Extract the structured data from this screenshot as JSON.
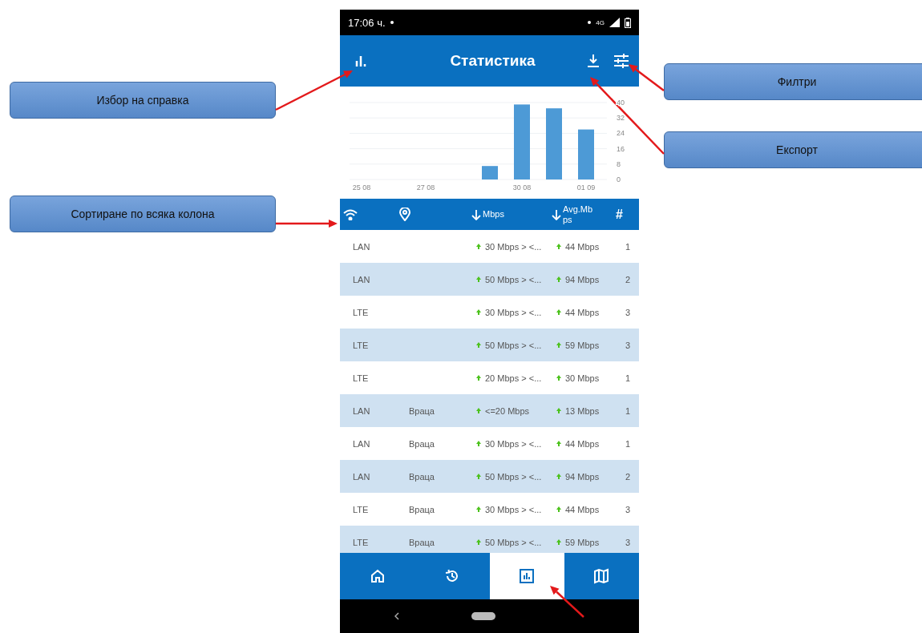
{
  "left_callouts": [
    "Избор на справка",
    "Сортиране по всяка колона"
  ],
  "right_callouts": [
    "Филтри",
    "Експорт"
  ],
  "status_bar": {
    "time": "17:06 ч.",
    "network": "4G"
  },
  "app_bar": {
    "title": "Статистика"
  },
  "chart_data": {
    "type": "bar",
    "categories": [
      "25 08",
      null,
      "27 08",
      null,
      null,
      "30 08",
      null,
      "01 09"
    ],
    "values": [
      null,
      null,
      null,
      null,
      7,
      39,
      37,
      26
    ],
    "grid": true,
    "ylim": [
      0,
      40
    ],
    "yticks": [
      0,
      8,
      16,
      24,
      32,
      40
    ]
  },
  "table": {
    "columns": [
      {
        "kind": "wifi"
      },
      {
        "kind": "location"
      },
      {
        "kind": "sort",
        "label": "Mbps"
      },
      {
        "kind": "sort",
        "label": "Avg.Mbps"
      },
      {
        "kind": "text",
        "label": "#"
      }
    ],
    "rows": [
      {
        "type": "LAN",
        "speed": "30 Mbps > <...",
        "avg": "44 Mbps",
        "count": "1"
      },
      {
        "type": "LAN",
        "speed": "50 Mbps > <...",
        "avg": "94 Mbps",
        "count": "2"
      },
      {
        "type": "LTE",
        "speed": "30 Mbps > <...",
        "avg": "44 Mbps",
        "count": "3"
      },
      {
        "type": "LTE",
        "speed": "50 Mbps > <...",
        "avg": "59 Mbps",
        "count": "3"
      },
      {
        "type": "LTE",
        "speed": "20 Mbps > <...",
        "avg": "30 Mbps",
        "count": "1"
      },
      {
        "type": "LAN",
        "place": "Враца",
        "speed": "<=20 Mbps",
        "avg": "13 Mbps",
        "count": "1"
      },
      {
        "type": "LAN",
        "place": "Враца",
        "speed": "30 Mbps > <...",
        "avg": "44 Mbps",
        "count": "1"
      },
      {
        "type": "LAN",
        "place": "Враца",
        "speed": "50 Mbps > <...",
        "avg": "94 Mbps",
        "count": "2"
      },
      {
        "type": "LTE",
        "place": "Враца",
        "speed": "30 Mbps > <...",
        "avg": "44 Mbps",
        "count": "3"
      },
      {
        "type": "LTE",
        "place": "Враца",
        "speed": "50 Mbps > <...",
        "avg": "59 Mbps",
        "count": "3"
      }
    ]
  },
  "bottom_nav": [
    {
      "kind": "home",
      "selected": false
    },
    {
      "kind": "history",
      "selected": false
    },
    {
      "kind": "stats",
      "selected": true
    },
    {
      "kind": "map",
      "selected": false
    }
  ]
}
